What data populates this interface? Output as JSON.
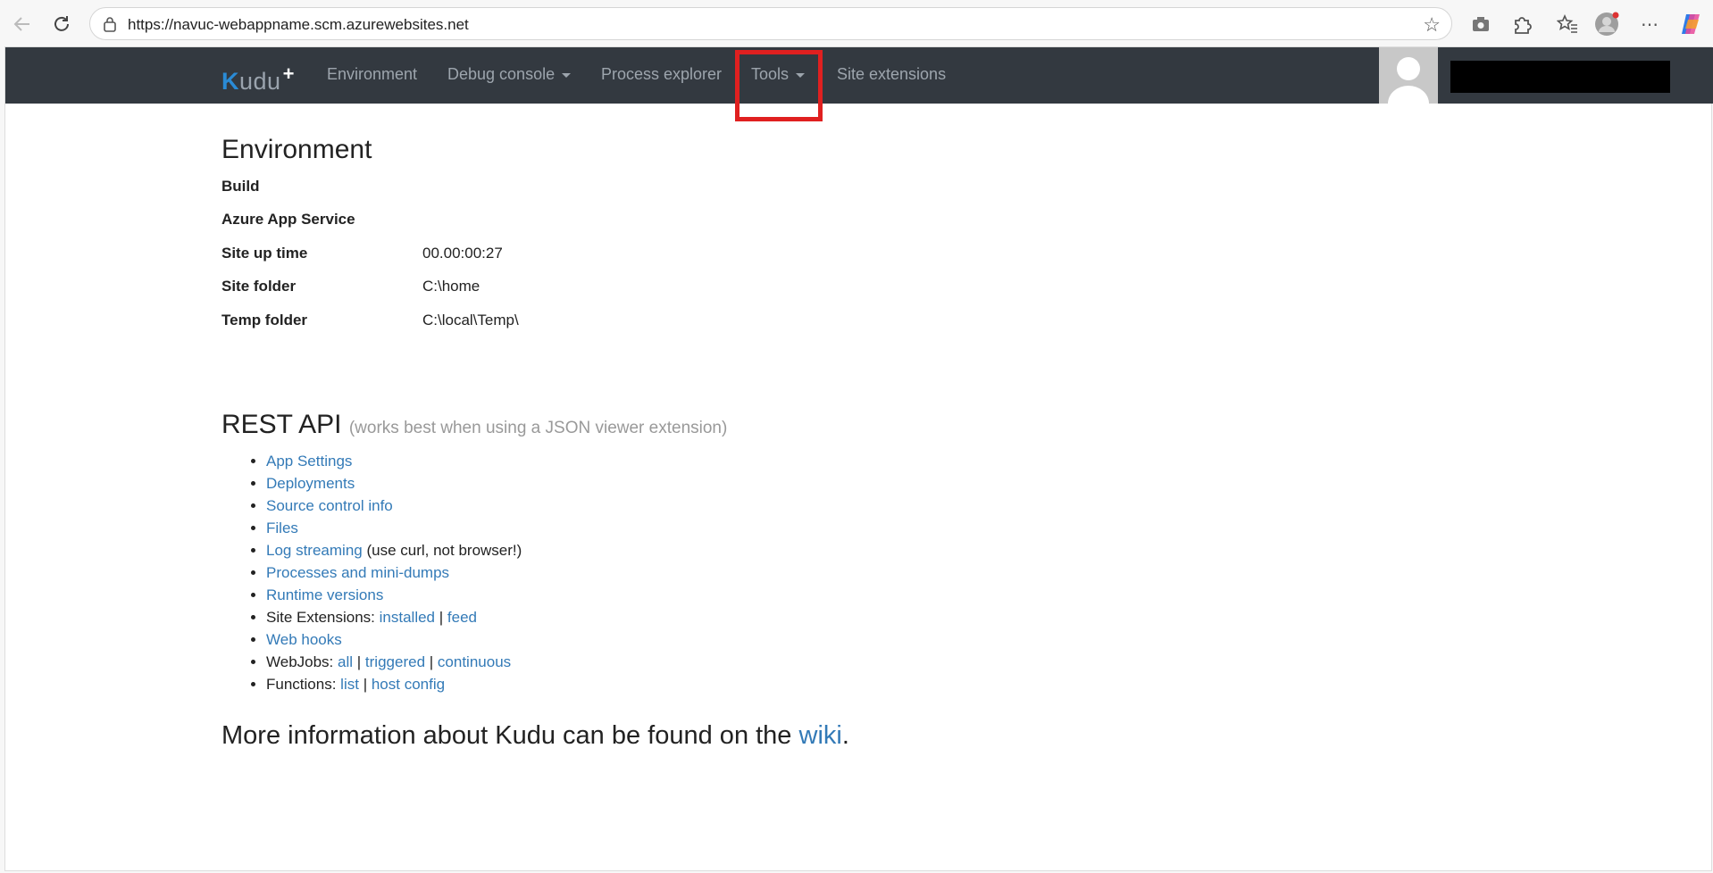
{
  "browser": {
    "url": "https://navuc-webappname.scm.azurewebsites.net",
    "icons": [
      "back-icon",
      "refresh-icon",
      "site-info-icon",
      "favorite-star-icon",
      "screenshot-icon",
      "extensions-icon",
      "favorites-icon",
      "profile-icon",
      "more-icon",
      "copilot-icon"
    ]
  },
  "navbar": {
    "brand": "Kudu",
    "brand_first": "K",
    "brand_rest": "udu",
    "brand_plus": "+",
    "items": {
      "environment": "Environment",
      "debug_console": "Debug console",
      "process_explorer": "Process explorer",
      "tools": "Tools",
      "site_extensions": "Site extensions"
    },
    "highlight_color": "#e02020"
  },
  "environment": {
    "title": "Environment",
    "rows": [
      {
        "key": "Build",
        "value": ""
      },
      {
        "key": "Azure App Service",
        "value": ""
      },
      {
        "key": "Site up time",
        "value": "00.00:00:27"
      },
      {
        "key": "Site folder",
        "value": "C:\\home"
      },
      {
        "key": "Temp folder",
        "value": "C:\\local\\Temp\\"
      }
    ]
  },
  "rest_api": {
    "title": "REST API",
    "subtitle": "(works best when using a JSON viewer extension)",
    "links": {
      "app_settings": "App Settings",
      "deployments": "Deployments",
      "source_control": "Source control info",
      "files": "Files",
      "log_streaming": "Log streaming",
      "log_streaming_note": "(use curl, not browser!)",
      "processes": "Processes and mini-dumps",
      "runtime": "Runtime versions",
      "site_ext_label": "Site Extensions:",
      "installed": "installed",
      "feed": "feed",
      "web_hooks": "Web hooks",
      "webjobs_label": "WebJobs:",
      "all": "all",
      "triggered": "triggered",
      "continuous": "continuous",
      "functions_label": "Functions:",
      "list": "list",
      "host_config": "host config",
      "sep": "|"
    }
  },
  "footer": {
    "text": "More information about Kudu can be found on the",
    "link": "wiki",
    "end": "."
  },
  "colors": {
    "navbar": "#333940",
    "link": "#337ab7",
    "accent": "#2a8bd6"
  }
}
